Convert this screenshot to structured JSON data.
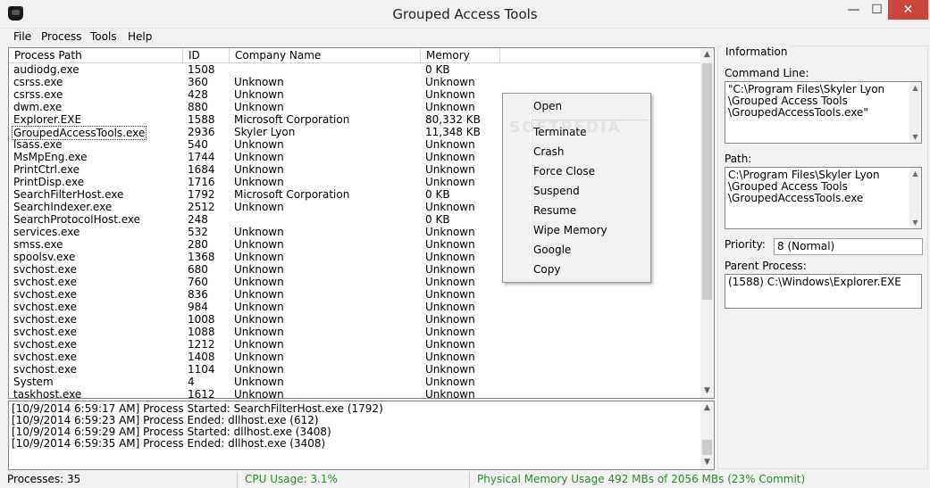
{
  "window": {
    "title": "Grouped Access Tools",
    "minimize_glyph": "—",
    "maximize_glyph": "☐",
    "close_glyph": "✕",
    "close_color": "#c7473d"
  },
  "menu": [
    "File",
    "Process",
    "Tools",
    "Help"
  ],
  "process_list": {
    "columns": [
      "Process Path",
      "ID",
      "Company Name",
      "Memory"
    ],
    "rows": [
      {
        "path": "audiodg.exe",
        "id": "1508",
        "company": "",
        "memory": "0 KB"
      },
      {
        "path": "csrss.exe",
        "id": "360",
        "company": "Unknown",
        "memory": "Unknown"
      },
      {
        "path": "csrss.exe",
        "id": "428",
        "company": "Unknown",
        "memory": "Unknown"
      },
      {
        "path": "dwm.exe",
        "id": "880",
        "company": "Unknown",
        "memory": "Unknown"
      },
      {
        "path": "Explorer.EXE",
        "id": "1588",
        "company": "Microsoft Corporation",
        "memory": "80,332 KB"
      },
      {
        "path": "GroupedAccessTools.exe",
        "id": "2936",
        "company": "Skyler Lyon",
        "memory": "11,348 KB",
        "selected": true
      },
      {
        "path": "lsass.exe",
        "id": "540",
        "company": "Unknown",
        "memory": "Unknown"
      },
      {
        "path": "MsMpEng.exe",
        "id": "1744",
        "company": "Unknown",
        "memory": "Unknown"
      },
      {
        "path": "PrintCtrl.exe",
        "id": "1684",
        "company": "Unknown",
        "memory": "Unknown"
      },
      {
        "path": "PrintDisp.exe",
        "id": "1716",
        "company": "Unknown",
        "memory": "Unknown"
      },
      {
        "path": "SearchFilterHost.exe",
        "id": "1792",
        "company": "Microsoft Corporation",
        "memory": "0 KB"
      },
      {
        "path": "SearchIndexer.exe",
        "id": "2512",
        "company": "Unknown",
        "memory": "Unknown"
      },
      {
        "path": "SearchProtocolHost.exe",
        "id": "248",
        "company": "",
        "memory": "0 KB"
      },
      {
        "path": "services.exe",
        "id": "532",
        "company": "Unknown",
        "memory": "Unknown"
      },
      {
        "path": "smss.exe",
        "id": "280",
        "company": "Unknown",
        "memory": "Unknown"
      },
      {
        "path": "spoolsv.exe",
        "id": "1368",
        "company": "Unknown",
        "memory": "Unknown"
      },
      {
        "path": "svchost.exe",
        "id": "680",
        "company": "Unknown",
        "memory": "Unknown"
      },
      {
        "path": "svchost.exe",
        "id": "760",
        "company": "Unknown",
        "memory": "Unknown"
      },
      {
        "path": "svchost.exe",
        "id": "836",
        "company": "Unknown",
        "memory": "Unknown"
      },
      {
        "path": "svchost.exe",
        "id": "984",
        "company": "Unknown",
        "memory": "Unknown"
      },
      {
        "path": "svchost.exe",
        "id": "1008",
        "company": "Unknown",
        "memory": "Unknown"
      },
      {
        "path": "svchost.exe",
        "id": "1088",
        "company": "Unknown",
        "memory": "Unknown"
      },
      {
        "path": "svchost.exe",
        "id": "1212",
        "company": "Unknown",
        "memory": "Unknown"
      },
      {
        "path": "svchost.exe",
        "id": "1408",
        "company": "Unknown",
        "memory": "Unknown"
      },
      {
        "path": "svchost.exe",
        "id": "1104",
        "company": "Unknown",
        "memory": "Unknown"
      },
      {
        "path": "System",
        "id": "4",
        "company": "Unknown",
        "memory": "Unknown"
      },
      {
        "path": "taskhost.exe",
        "id": "1612",
        "company": "Unknown",
        "memory": "Unknown"
      }
    ]
  },
  "context_menu": {
    "items": [
      "Open",
      "Terminate",
      "Crash",
      "Force Close",
      "Suspend",
      "Resume",
      "Wipe Memory",
      "Google",
      "Copy"
    ],
    "watermark": "SOFTPEDIA"
  },
  "log": [
    "[10/9/2014 6:59:17 AM] Process Started: SearchFilterHost.exe (1792)",
    "[10/9/2014 6:59:23 AM] Process Ended: dllhost.exe (612)",
    "[10/9/2014 6:59:29 AM] Process Started: dllhost.exe (3408)",
    "[10/9/2014 6:59:35 AM] Process Ended: dllhost.exe (3408)"
  ],
  "status": {
    "processes": "Processes: 35",
    "cpu": "CPU Usage: 3.1%",
    "memory": "Physical Memory Usage 492 MBs of 2056 MBs (23% Commit)",
    "cpu_color": "#2d8a2d",
    "memory_color": "#2d8a2d"
  },
  "info": {
    "group_title": "Information",
    "command_line_label": "Command Line:",
    "command_line_value": "\"C:\\Program Files\\Skyler Lyon\n\\Grouped Access Tools\n\\GroupedAccessTools.exe\"",
    "path_label": "Path:",
    "path_value": "C:\\Program Files\\Skyler Lyon\n\\Grouped Access Tools\n\\GroupedAccessTools.exe",
    "priority_label": "Priority:",
    "priority_value": "8 (Normal)",
    "parent_label": "Parent Process:",
    "parent_value": "(1588) C:\\Windows\\Explorer.EXE"
  }
}
